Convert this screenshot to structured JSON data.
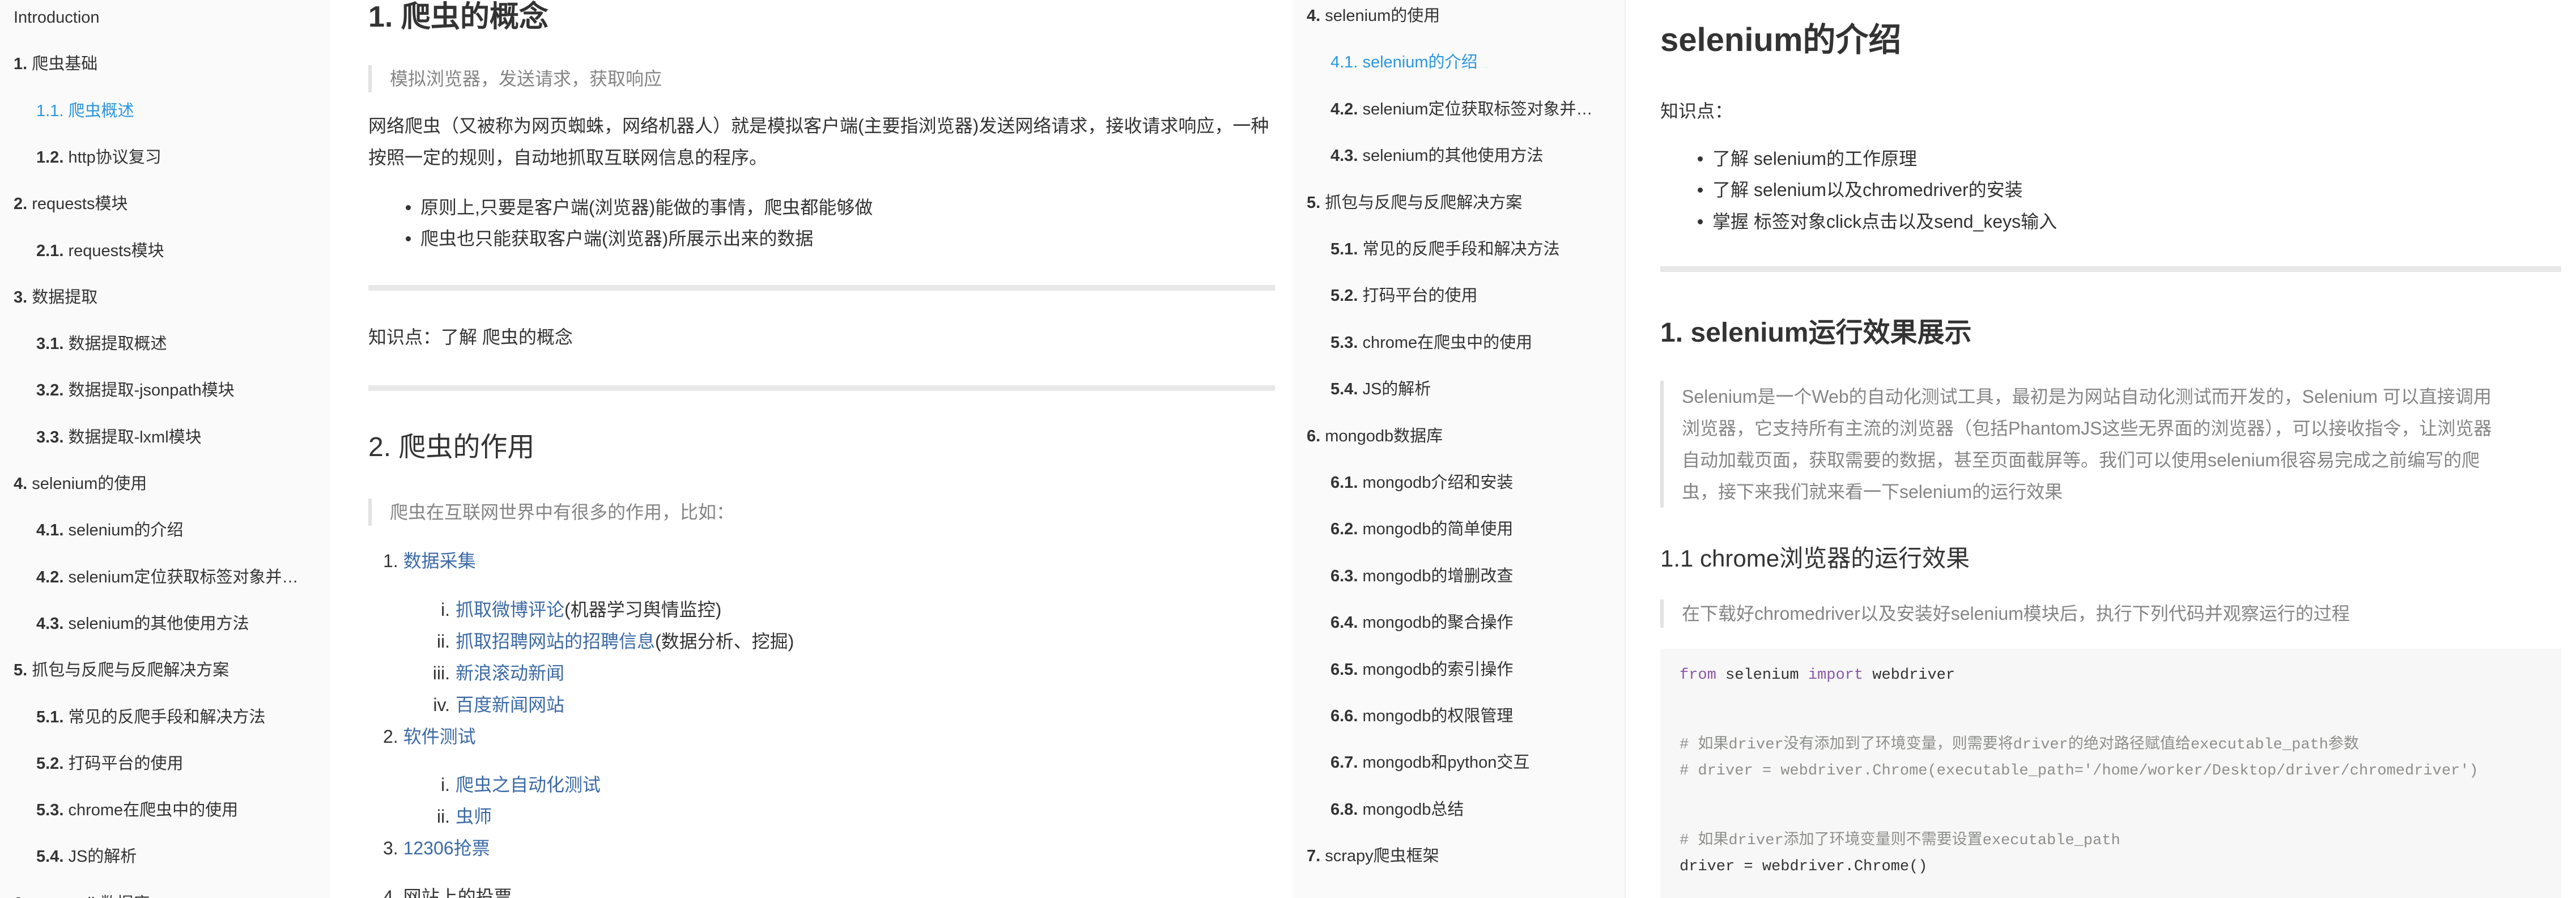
{
  "left_sidebar": {
    "items": [
      {
        "num": "",
        "label": "Introduction",
        "level": 0,
        "active": false
      },
      {
        "num": "1.",
        "label": "爬虫基础",
        "level": 0,
        "active": false
      },
      {
        "num": "1.1.",
        "label": "爬虫概述",
        "level": 1,
        "active": true
      },
      {
        "num": "1.2.",
        "label": "http协议复习",
        "level": 1,
        "active": false
      },
      {
        "num": "2.",
        "label": "requests模块",
        "level": 0,
        "active": false
      },
      {
        "num": "2.1.",
        "label": "requests模块",
        "level": 1,
        "active": false
      },
      {
        "num": "3.",
        "label": "数据提取",
        "level": 0,
        "active": false
      },
      {
        "num": "3.1.",
        "label": "数据提取概述",
        "level": 1,
        "active": false
      },
      {
        "num": "3.2.",
        "label": "数据提取-jsonpath模块",
        "level": 1,
        "active": false
      },
      {
        "num": "3.3.",
        "label": "数据提取-lxml模块",
        "level": 1,
        "active": false
      },
      {
        "num": "4.",
        "label": "selenium的使用",
        "level": 0,
        "active": false
      },
      {
        "num": "4.1.",
        "label": "selenium的介绍",
        "level": 1,
        "active": false
      },
      {
        "num": "4.2.",
        "label": "selenium定位获取标签对象并…",
        "level": 1,
        "active": false
      },
      {
        "num": "4.3.",
        "label": "selenium的其他使用方法",
        "level": 1,
        "active": false
      },
      {
        "num": "5.",
        "label": "抓包与反爬与反爬解决方案",
        "level": 0,
        "active": false
      },
      {
        "num": "5.1.",
        "label": "常见的反爬手段和解决方法",
        "level": 1,
        "active": false
      },
      {
        "num": "5.2.",
        "label": "打码平台的使用",
        "level": 1,
        "active": false
      },
      {
        "num": "5.3.",
        "label": "chrome在爬虫中的使用",
        "level": 1,
        "active": false
      },
      {
        "num": "5.4.",
        "label": "JS的解析",
        "level": 1,
        "active": false
      },
      {
        "num": "6.",
        "label": "mongodb数据库",
        "level": 0,
        "active": false
      }
    ]
  },
  "left_content": {
    "h1": "1. 爬虫的概念",
    "quote1": "模拟浏览器，发送请求，获取响应",
    "para1": "网络爬虫（又被称为网页蜘蛛，网络机器人）就是模拟客户端(主要指浏览器)发送网络请求，接收请求响应，一种按照一定的规则，自动地抓取互联网信息的程序。",
    "bullets": [
      "原则上,只要是客户端(浏览器)能做的事情，爬虫都能够做",
      "爬虫也只能获取客户端(浏览器)所展示出来的数据"
    ],
    "knowledge": "知识点：了解 爬虫的概念",
    "h2": "2. 爬虫的作用",
    "quote2": "爬虫在互联网世界中有很多的作用，比如：",
    "list": [
      {
        "marker": "1.",
        "link": "数据采集",
        "rest": "",
        "level": 0
      },
      {
        "marker": "i.",
        "link": "抓取微博评论",
        "rest": "(机器学习舆情监控)",
        "level": 1
      },
      {
        "marker": "ii.",
        "link": "抓取招聘网站的招聘信息",
        "rest": "(数据分析、挖掘)",
        "level": 1
      },
      {
        "marker": "iii.",
        "link": "新浪滚动新闻",
        "rest": "",
        "level": 1
      },
      {
        "marker": "iv.",
        "link": "百度新闻网站",
        "rest": "",
        "level": 1
      },
      {
        "marker": "2.",
        "link": "软件测试",
        "rest": "",
        "level": 0
      },
      {
        "marker": "i.",
        "link": "爬虫之自动化测试",
        "rest": "",
        "level": 1
      },
      {
        "marker": "ii.",
        "link": "虫师",
        "rest": "",
        "level": 1
      },
      {
        "marker": "3.",
        "link": "12306抢票",
        "rest": "",
        "level": 0
      },
      {
        "marker": "4.",
        "link": "",
        "rest": "网站上的投票",
        "level": 0
      }
    ]
  },
  "right_sidebar": {
    "items": [
      {
        "num": "4.",
        "label": "selenium的使用",
        "level": 0,
        "active": false
      },
      {
        "num": "4.1.",
        "label": "selenium的介绍",
        "level": 1,
        "active": true
      },
      {
        "num": "4.2.",
        "label": "selenium定位获取标签对象并…",
        "level": 1,
        "active": false
      },
      {
        "num": "4.3.",
        "label": "selenium的其他使用方法",
        "level": 1,
        "active": false
      },
      {
        "num": "5.",
        "label": "抓包与反爬与反爬解决方案",
        "level": 0,
        "active": false
      },
      {
        "num": "5.1.",
        "label": "常见的反爬手段和解决方法",
        "level": 1,
        "active": false
      },
      {
        "num": "5.2.",
        "label": "打码平台的使用",
        "level": 1,
        "active": false
      },
      {
        "num": "5.3.",
        "label": "chrome在爬虫中的使用",
        "level": 1,
        "active": false
      },
      {
        "num": "5.4.",
        "label": "JS的解析",
        "level": 1,
        "active": false
      },
      {
        "num": "6.",
        "label": "mongodb数据库",
        "level": 0,
        "active": false
      },
      {
        "num": "6.1.",
        "label": "mongodb介绍和安装",
        "level": 1,
        "active": false
      },
      {
        "num": "6.2.",
        "label": "mongodb的简单使用",
        "level": 1,
        "active": false
      },
      {
        "num": "6.3.",
        "label": "mongodb的增删改查",
        "level": 1,
        "active": false
      },
      {
        "num": "6.4.",
        "label": "mongodb的聚合操作",
        "level": 1,
        "active": false
      },
      {
        "num": "6.5.",
        "label": "mongodb的索引操作",
        "level": 1,
        "active": false
      },
      {
        "num": "6.6.",
        "label": "mongodb的权限管理",
        "level": 1,
        "active": false
      },
      {
        "num": "6.7.",
        "label": "mongodb和python交互",
        "level": 1,
        "active": false
      },
      {
        "num": "6.8.",
        "label": "mongodb总结",
        "level": 1,
        "active": false
      },
      {
        "num": "7.",
        "label": "scrapy爬虫框架",
        "level": 0,
        "active": false
      }
    ]
  },
  "right_content": {
    "title": "selenium的介绍",
    "knowledge_label": "知识点：",
    "bullets": [
      "了解 selenium的工作原理",
      "了解 selenium以及chromedriver的安装",
      "掌握 标签对象click点击以及send_keys输入"
    ],
    "h2": "1. selenium运行效果展示",
    "quote1": "Selenium是一个Web的自动化测试工具，最初是为网站自动化测试而开发的，Selenium 可以直接调用浏览器，它支持所有主流的浏览器（包括PhantomJS这些无界面的浏览器），可以接收指令，让浏览器自动加载页面，获取需要的数据，甚至页面截屏等。我们可以使用selenium很容易完成之前编写的爬虫，接下来我们就来看一下selenium的运行效果",
    "quote1_lines": [
      "Selenium是一个Web的自动化测试工具，最初是为网站自动化测试而开发的，Selenium 可以直接调用",
      "浏览器，它支持所有主流的浏览器（包括PhantomJS这些无界面的浏览器），可以接收指令，让浏览器",
      "自动加载页面，获取需要的数据，甚至页面截屏等。我们可以使用selenium很容易完成之前编写的爬",
      "虫，接下来我们就来看一下selenium的运行效果"
    ],
    "h3": "1.1 chrome浏览器的运行效果",
    "quote2": "在下载好chromedriver以及安装好selenium模块后，执行下列代码并观察运行的过程",
    "code": {
      "l1_kw1": "from",
      "l1_mid": " selenium ",
      "l1_kw2": "import",
      "l1_end": " webdriver",
      "l2": "# 如果driver没有添加到了环境变量，则需要将driver的绝对路径赋值给executable_path参数",
      "l3": "# driver = webdriver.Chrome(executable_path='/home/worker/Desktop/driver/chromedriver')",
      "l4": "# 如果driver添加了环境变量则不需要设置executable_path",
      "l5": "driver = webdriver.Chrome()"
    }
  },
  "colors": {
    "active": "#2a96e0",
    "link": "#3c6aa6",
    "sidebar_bg": "#fafafa",
    "quote_text": "#858585"
  }
}
